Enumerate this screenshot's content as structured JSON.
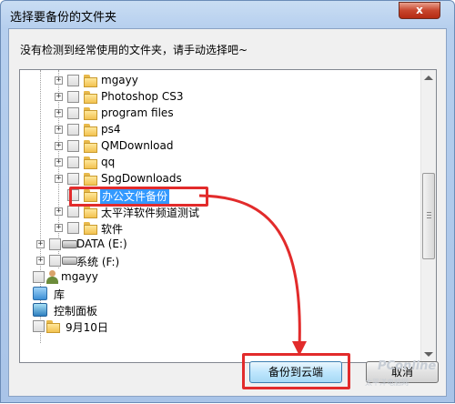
{
  "dialog": {
    "title": "选择要备份的文件夹",
    "close_label": "x",
    "instruction": "没有检测到经常使用的文件夹，请手动选择吧~"
  },
  "tree": {
    "items": [
      {
        "label": "mgayy",
        "type": "folder"
      },
      {
        "label": "Photoshop CS3",
        "type": "folder"
      },
      {
        "label": "program files",
        "type": "folder"
      },
      {
        "label": "ps4",
        "type": "folder"
      },
      {
        "label": "QMDownload",
        "type": "folder"
      },
      {
        "label": "qq",
        "type": "folder"
      },
      {
        "label": "SpgDownloads",
        "type": "folder"
      },
      {
        "label": "办公文件备份",
        "type": "folder",
        "selected": true
      },
      {
        "label": "太平洋软件频道测试",
        "type": "folder"
      },
      {
        "label": "软件",
        "type": "folder"
      },
      {
        "label": "DATA (E:)",
        "type": "drive"
      },
      {
        "label": "系统 (F:)",
        "type": "drive"
      },
      {
        "label": "mgayy",
        "type": "user"
      },
      {
        "label": "库",
        "type": "library"
      },
      {
        "label": "控制面板",
        "type": "control-panel"
      },
      {
        "label": "9月10日",
        "type": "folder"
      }
    ],
    "expander_symbol": "+"
  },
  "buttons": {
    "backup_label": "备份到云端",
    "cancel_label": "取消"
  },
  "watermark": {
    "logo": "PConline",
    "sub": "太平洋电脑网"
  },
  "colors": {
    "highlight": "#e22b2b",
    "selection": "#3399ff"
  }
}
